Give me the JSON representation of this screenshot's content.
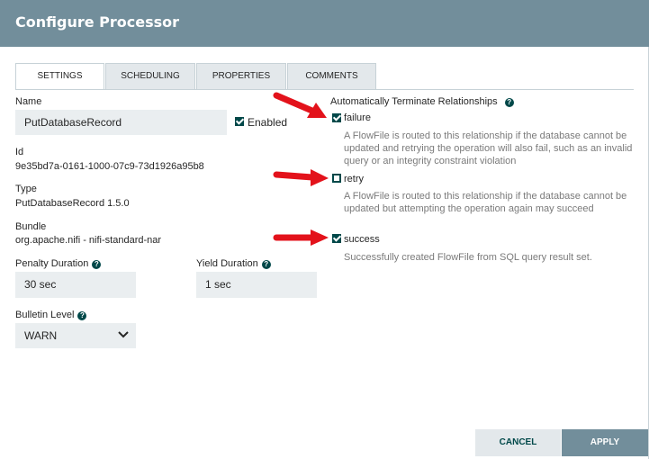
{
  "dialog": {
    "title": "Configure Processor"
  },
  "tabs": [
    {
      "label": "SETTINGS",
      "active": true
    },
    {
      "label": "SCHEDULING",
      "active": false
    },
    {
      "label": "PROPERTIES",
      "active": false
    },
    {
      "label": "COMMENTS",
      "active": false
    }
  ],
  "settings": {
    "name_label": "Name",
    "name_value": "PutDatabaseRecord",
    "enabled_label": "Enabled",
    "enabled": true,
    "id_label": "Id",
    "id_value": "9e35bd7a-0161-1000-07c9-73d1926a95b8",
    "type_label": "Type",
    "type_value": "PutDatabaseRecord 1.5.0",
    "bundle_label": "Bundle",
    "bundle_value": "org.apache.nifi - nifi-standard-nar",
    "penalty_label": "Penalty Duration",
    "penalty_value": "30 sec",
    "yield_label": "Yield Duration",
    "yield_value": "1 sec",
    "bulletin_label": "Bulletin Level",
    "bulletin_value": "WARN"
  },
  "relationships": {
    "title": "Automatically Terminate Relationships",
    "items": [
      {
        "name": "failure",
        "checked": true,
        "description": "A FlowFile is routed to this relationship if the database cannot be updated and retrying the operation will also fail, such as an invalid query or an integrity constraint violation"
      },
      {
        "name": "retry",
        "checked": false,
        "description": "A FlowFile is routed to this relationship if the database cannot be updated but attempting the operation again may succeed"
      },
      {
        "name": "success",
        "checked": true,
        "description": "Successfully created FlowFile from SQL query result set."
      }
    ]
  },
  "footer": {
    "cancel_label": "CANCEL",
    "apply_label": "APPLY"
  },
  "colors": {
    "header": "#728e9b",
    "accent": "#004849",
    "apply_bg": "#728e9b",
    "cancel_bg": "#e3e8eb",
    "annotation_arrow": "#e3121b"
  },
  "icons": {
    "help": "help-circle-icon",
    "checkbox": "checkbox-icon",
    "dropdown": "chevron-down-icon",
    "annotation": "red-arrow-icon"
  }
}
